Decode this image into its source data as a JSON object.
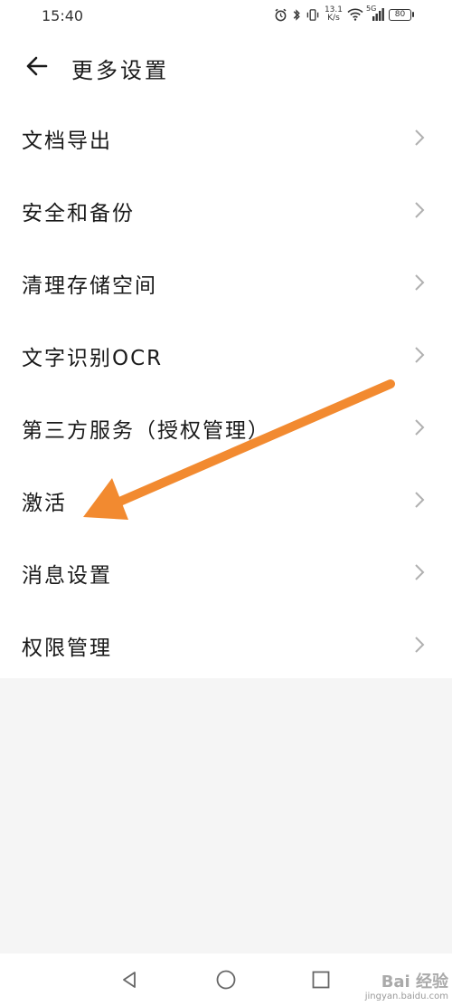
{
  "status_bar": {
    "time": "15:40",
    "net_speed_value": "13.1",
    "net_speed_unit": "K/s",
    "network_type": "5G",
    "battery": "80"
  },
  "header": {
    "title": "更多设置"
  },
  "settings": {
    "items": [
      {
        "label": "文档导出"
      },
      {
        "label": "安全和备份"
      },
      {
        "label": "清理存储空间"
      },
      {
        "label": "文字识别OCR"
      },
      {
        "label": "第三方服务（授权管理）"
      },
      {
        "label": "激活"
      },
      {
        "label": "消息设置"
      },
      {
        "label": "权限管理"
      }
    ]
  },
  "annotation": {
    "color": "#f28a30",
    "points_to": "激活"
  },
  "watermark": {
    "main": "Bai 经验",
    "url": "jingyan.baidu.com"
  },
  "colors": {
    "background": "#f5f5f5",
    "surface": "#ffffff",
    "text": "#1a1a1a",
    "chevron": "#b0b0b0"
  }
}
